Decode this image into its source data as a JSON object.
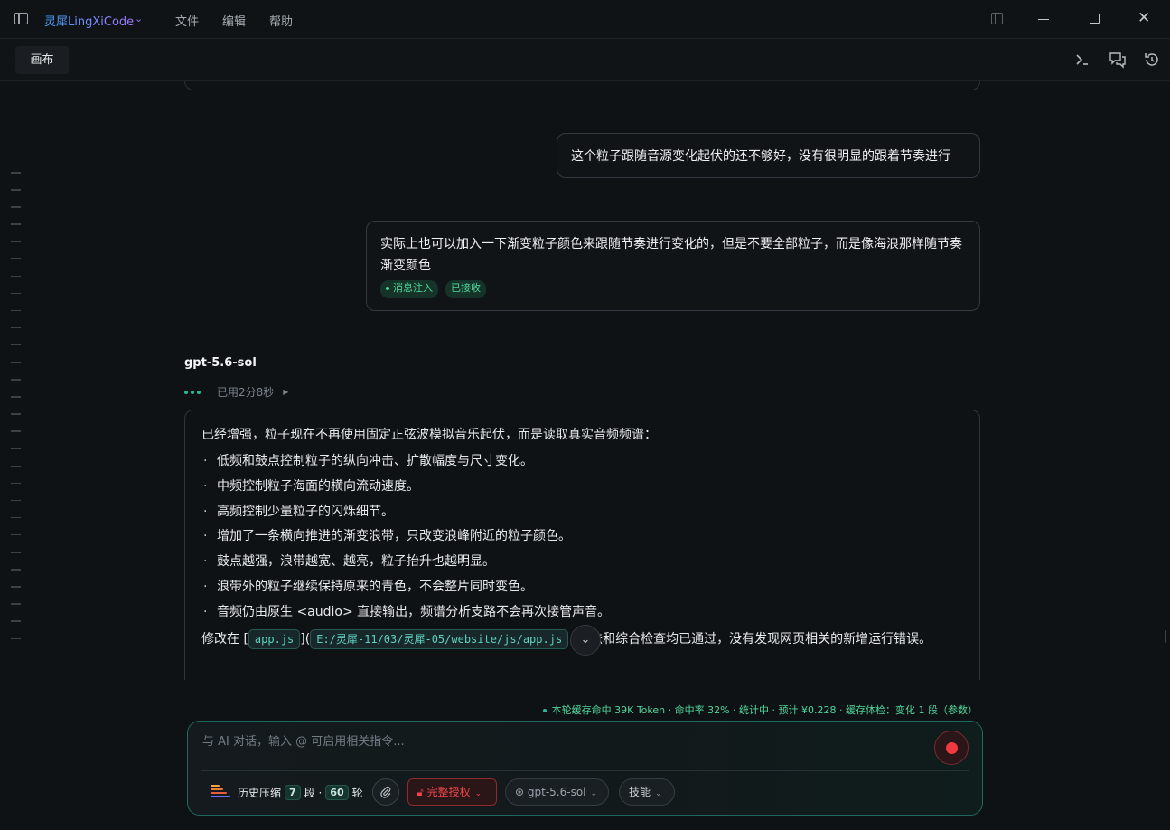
{
  "titlebar": {
    "app_name": "灵犀LingXiCode",
    "menus": [
      "文件",
      "编辑",
      "帮助"
    ]
  },
  "tabstrip": {
    "active_tab": "画布"
  },
  "conversation": {
    "user_message_1": "这个粒子跟随音源变化起伏的还不够好，没有很明显的跟着节奏进行",
    "user_message_2": "实际上也可以加入一下渐变粒子颜色来跟随节奏进行变化的，但是不要全部粒子，而是像海浪那样随节奏渐变颜色",
    "tag_injected": "消息注入",
    "tag_received": "已接收",
    "assistant_model": "gpt-5.6-sol",
    "elapsed": "已用2分8秒",
    "reply_intro": "已经增强，粒子现在不再使用固定正弦波模拟音乐起伏，而是读取真实音频频谱：",
    "reply_bullets": [
      "低频和鼓点控制粒子的纵向冲击、扩散幅度与尺寸变化。",
      "中频控制粒子海面的横向流动速度。",
      "高频控制少量粒子的闪烁细节。",
      "增加了一条横向推进的渐变浪带，只改变浪峰附近的粒子颜色。",
      "鼓点越强，浪带越宽、越亮，粒子抬升也越明显。",
      "浪带外的粒子继续保持原来的青色，不会整片同时变色。",
      "音频仍由原生 <audio> 直接输出，频谱分析支路不会再次接管声音。"
    ],
    "modified_prefix": "修改在 [",
    "file_name": "app.js",
    "link_sep": "](",
    "file_path": "E:/灵犀-11/03/灵犀-05/website/js/app.js",
    "modified_suffix": "语法和综合检查均已通过，没有发现网页相关的新增运行错误。"
  },
  "composer": {
    "cache_info": "本轮缓存命中 39K Token · 命中率 32% · 统计中 · 预计 ¥0.228 · 缓存体检：变化 1 段（参数）",
    "placeholder": "与 AI 对话，输入 @ 可启用相关指令...",
    "history_label": "历史压缩",
    "segments_count": "7",
    "segments_unit": "段 ·",
    "rounds_count": "60",
    "rounds_unit": "轮",
    "auth_label": "完整授权",
    "model_label": "gpt-5.6-sol",
    "skills_label": "技能"
  },
  "colors": {
    "accent_teal": "#2bb99a",
    "danger_red": "#f03a3f",
    "brand_gradient": [
      "#3fa3ff",
      "#a578ff"
    ]
  }
}
